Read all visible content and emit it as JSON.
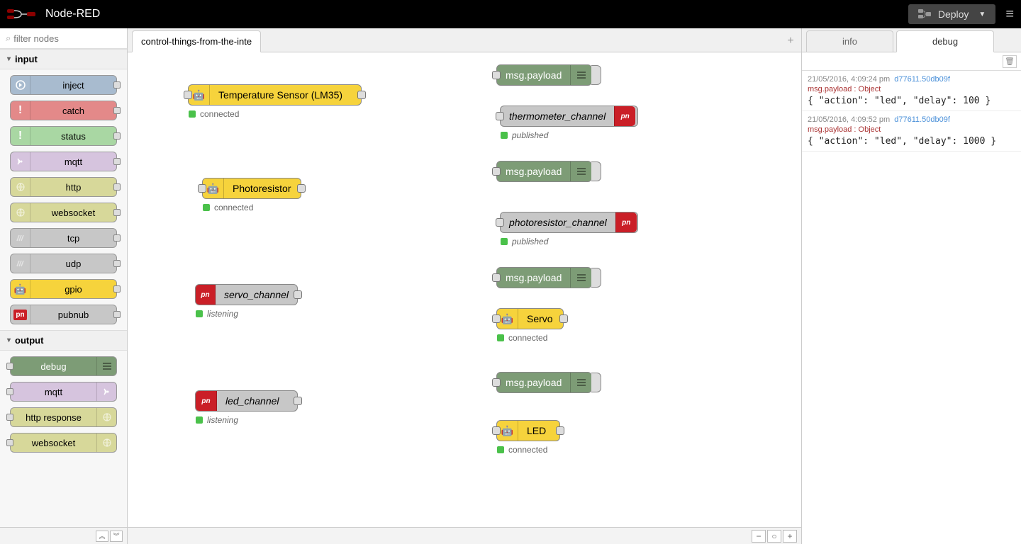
{
  "header": {
    "title": "Node-RED",
    "deploy_label": "Deploy"
  },
  "palette": {
    "filter_placeholder": "filter nodes",
    "categories": [
      {
        "name": "input",
        "nodes": [
          {
            "label": "inject",
            "color": "c-blue",
            "inPort": false,
            "outPort": true,
            "iconSide": "left",
            "icon": "arrow"
          },
          {
            "label": "catch",
            "color": "c-red",
            "inPort": false,
            "outPort": true,
            "iconSide": "left",
            "icon": "bang"
          },
          {
            "label": "status",
            "color": "c-green",
            "inPort": false,
            "outPort": true,
            "iconSide": "left",
            "icon": "bang"
          },
          {
            "label": "mqtt",
            "color": "c-purple",
            "inPort": false,
            "outPort": true,
            "iconSide": "left",
            "icon": "radio"
          },
          {
            "label": "http",
            "color": "c-olive",
            "inPort": false,
            "outPort": true,
            "iconSide": "left",
            "icon": "globe"
          },
          {
            "label": "websocket",
            "color": "c-olive",
            "inPort": false,
            "outPort": true,
            "iconSide": "left",
            "icon": "globe"
          },
          {
            "label": "tcp",
            "color": "c-grey",
            "inPort": false,
            "outPort": true,
            "iconSide": "left",
            "icon": "net"
          },
          {
            "label": "udp",
            "color": "c-grey",
            "inPort": false,
            "outPort": true,
            "iconSide": "left",
            "icon": "net"
          },
          {
            "label": "gpio",
            "color": "c-yellow",
            "inPort": false,
            "outPort": true,
            "iconSide": "left",
            "icon": "robot"
          },
          {
            "label": "pubnub",
            "color": "c-grey",
            "inPort": false,
            "outPort": true,
            "iconSide": "left",
            "icon": "pn"
          }
        ]
      },
      {
        "name": "output",
        "nodes": [
          {
            "label": "debug",
            "color": "c-dgreen",
            "inPort": true,
            "outPort": false,
            "iconSide": "right",
            "icon": "debug"
          },
          {
            "label": "mqtt",
            "color": "c-purple",
            "inPort": true,
            "outPort": false,
            "iconSide": "right",
            "icon": "radio"
          },
          {
            "label": "http response",
            "color": "c-olive",
            "inPort": true,
            "outPort": false,
            "iconSide": "right",
            "icon": "globe"
          },
          {
            "label": "websocket",
            "color": "c-olive",
            "inPort": true,
            "outPort": false,
            "iconSide": "right",
            "icon": "globe"
          }
        ]
      }
    ]
  },
  "workspace": {
    "tab_name": "control-things-from-the-inte",
    "nodes": {
      "temp": {
        "label": "Temperature Sensor (LM35)",
        "status": "connected"
      },
      "temp_debug": {
        "label": "msg.payload"
      },
      "temp_pub": {
        "label": "thermometer_channel",
        "status": "published"
      },
      "photo": {
        "label": "Photoresistor",
        "status": "connected"
      },
      "photo_debug": {
        "label": "msg.payload"
      },
      "photo_pub": {
        "label": "photoresistor_channel",
        "status": "published"
      },
      "servo_ch": {
        "label": "servo_channel",
        "status": "listening"
      },
      "servo_debug": {
        "label": "msg.payload"
      },
      "servo": {
        "label": "Servo",
        "status": "connected"
      },
      "led_ch": {
        "label": "led_channel",
        "status": "listening"
      },
      "led_debug": {
        "label": "msg.payload"
      },
      "led": {
        "label": "LED",
        "status": "connected"
      }
    }
  },
  "sidebar": {
    "tab_info": "info",
    "tab_debug": "debug",
    "messages": [
      {
        "ts": "21/05/2016, 4:09:24 pm",
        "node": "d77611.50db09f",
        "topic": "msg.payload : Object",
        "payload": "{ \"action\": \"led\", \"delay\": 100 }"
      },
      {
        "ts": "21/05/2016, 4:09:52 pm",
        "node": "d77611.50db09f",
        "topic": "msg.payload : Object",
        "payload": "{ \"action\": \"led\", \"delay\": 1000 }"
      }
    ]
  },
  "colors": {
    "status_green": "#4ac14a"
  }
}
